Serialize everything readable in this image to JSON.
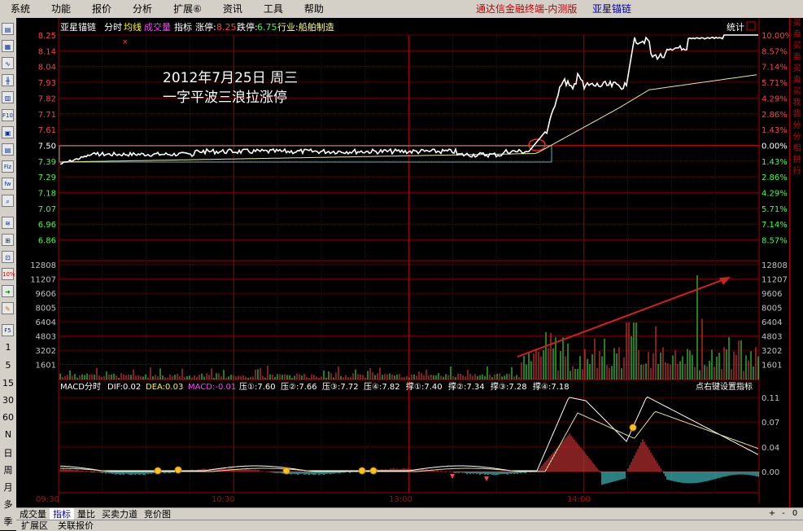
{
  "menu": [
    "系统",
    "功能",
    "报价",
    "分析",
    "扩展⑥",
    "资讯",
    "工具",
    "帮助"
  ],
  "app_title": "通达信金融终端-内测版",
  "stock_name": "亚星锚链",
  "left_toolbar": {
    "icons": [
      "book-icon",
      "table-icon",
      "line-chart-icon",
      "candle-icon",
      "bar-icon",
      "f10-icon",
      "news-icon",
      "fiz-icon",
      "fw-icon",
      "search-icon",
      "kline-icon",
      "compare-icon",
      "zoom-icon",
      "percent-icon",
      "export-icon",
      "pencil-icon",
      "f5-icon"
    ],
    "periods": [
      "1",
      "5",
      "15",
      "30",
      "60",
      "N",
      "日",
      "周",
      "月",
      "多",
      "季"
    ]
  },
  "right_strip": [
    "买",
    "卖",
    "买",
    "卖",
    "买",
    "卖",
    "买",
    "我",
    "我",
    "分",
    "分",
    "相",
    "拼",
    "行"
  ],
  "header": {
    "name": "亚星锚链",
    "tabs": [
      "分时",
      "均线",
      "成交量",
      "指标"
    ],
    "limit_up_label": "涨停:",
    "limit_up": "8.25",
    "limit_down_label": "跌停:",
    "limit_down": "6.75",
    "industry": "行业:船舶制造",
    "stats": "统计",
    "cross_mark": "×"
  },
  "annotation": {
    "line1": "2012年7月25日  周三",
    "line2": "一字平波三浪拉涨停"
  },
  "price_axis": {
    "left": [
      "8.25",
      "8.14",
      "8.04",
      "7.93",
      "7.82",
      "7.71",
      "7.61",
      "7.50",
      "7.39",
      "7.29",
      "7.18",
      "7.07",
      "6.96",
      "6.86"
    ],
    "right": [
      "10.00%",
      "8.57%",
      "7.14%",
      "5.71%",
      "4.29%",
      "2.86%",
      "1.43%",
      "0.00%",
      "1.43%",
      "2.86%",
      "4.29%",
      "5.71%",
      "7.14%",
      "8.57%"
    ]
  },
  "volume_axis": [
    "12808",
    "11207",
    "9606",
    "8005",
    "6404",
    "4803",
    "3202",
    "1601"
  ],
  "macd_header": {
    "title": "MACD分时",
    "dif": "DIF:0.02",
    "dea": "DEA:0.03",
    "macd": "MACD:-0.01",
    "r1": "压①:7.60",
    "r2": "压②:7.66",
    "r3": "压③:7.72",
    "r4": "压④:7.82",
    "s1": "撑①:7.40",
    "s2": "撑②:7.34",
    "s3": "撑③:7.28",
    "s4": "撑④:7.18",
    "hint": "点右键设置指标"
  },
  "macd_axis": [
    "0.11",
    "0.07",
    "0.04",
    "0.00"
  ],
  "time_axis": [
    "09:30",
    "10:30",
    "13:00",
    "14:00"
  ],
  "bottom_tabs": [
    "成交量",
    "指标",
    "量比",
    "买卖力道",
    "竞价图"
  ],
  "bottom_controls": [
    "+",
    "-",
    "0"
  ],
  "status": [
    "扩展区",
    "关联报价"
  ],
  "colors": {
    "red": "#c00000",
    "grid": "#7a0000",
    "up": "#ff4040",
    "down": "#54ffff",
    "yellow": "#ffff00",
    "cyan": "#00c0c0"
  }
}
